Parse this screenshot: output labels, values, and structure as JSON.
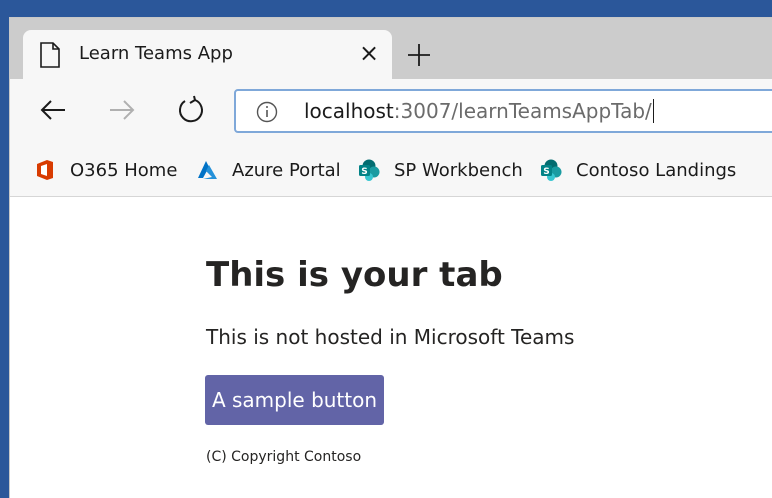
{
  "browser": {
    "tab": {
      "title": "Learn Teams App",
      "close_glyph": "×",
      "icon": "page-icon"
    },
    "new_tab_icon": "plus-icon",
    "nav": {
      "back_icon": "back-arrow-icon",
      "forward_icon": "forward-arrow-icon",
      "reload_icon": "reload-icon"
    },
    "address": {
      "info_icon": "info-icon",
      "host": "localhost",
      "path": ":3007/learnTeamsAppTab/"
    },
    "favorites": [
      {
        "label": "O365 Home",
        "icon": "office-icon"
      },
      {
        "label": "Azure Portal",
        "icon": "azure-icon"
      },
      {
        "label": "SP Workbench",
        "icon": "sharepoint-icon"
      },
      {
        "label": "Contoso Landings",
        "icon": "sharepoint-icon"
      }
    ]
  },
  "page": {
    "title": "This is your tab",
    "message": "This is not hosted in Microsoft Teams",
    "button_label": "A sample button",
    "copyright": "(C) Copyright Contoso"
  },
  "colors": {
    "accent_button": "#6264a7",
    "address_focus": "#7fa8d9",
    "office_red": "#d83b01",
    "azure_blue": "#0072c6",
    "sharepoint_teal": "#038387"
  }
}
